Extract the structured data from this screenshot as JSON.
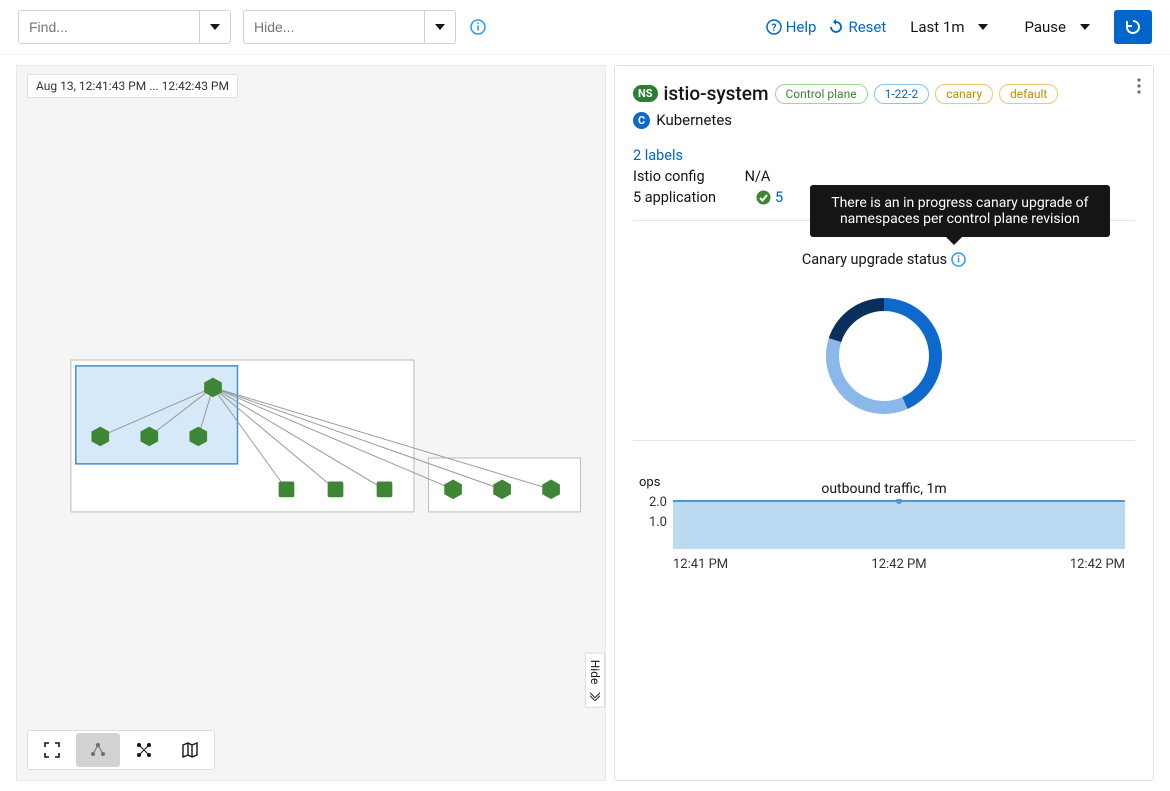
{
  "topbar": {
    "find_placeholder": "Find...",
    "hide_placeholder": "Hide...",
    "help": "Help",
    "reset": "Reset",
    "range": "Last 1m",
    "pause": "Pause"
  },
  "graph": {
    "timestamp": "Aug 13, 12:41:43 PM ... 12:42:43 PM",
    "hide_tab": "Hide"
  },
  "panel": {
    "ns_badge": "NS",
    "title": "istio-system",
    "c_badge": "C",
    "cluster": "Kubernetes",
    "pills": {
      "control_plane": "Control plane",
      "version": "1-22-2",
      "canary": "canary",
      "default": "default"
    },
    "labels_link": "2 labels",
    "istio_config_label": "Istio config",
    "istio_config_value": "N/A",
    "app_label": "5 application",
    "app_value": "5",
    "tooltip": "There is an in progress canary upgrade of namespaces per control plane revision",
    "canary_title": "Canary upgrade status",
    "ops_label": "ops",
    "traffic_title": "outbound traffic, 1m"
  },
  "chart_data": [
    {
      "type": "pie",
      "title": "Canary upgrade status",
      "series": [
        {
          "name": "segment-dark",
          "value": 25,
          "color": "#0a2f5c"
        },
        {
          "name": "segment-blue",
          "value": 40,
          "color": "#0d69cc"
        },
        {
          "name": "segment-light",
          "value": 35,
          "color": "#8bb8e8"
        }
      ]
    },
    {
      "type": "area",
      "title": "outbound traffic, 1m",
      "ylabel": "ops",
      "ylim": [
        0,
        2
      ],
      "y_ticks": [
        "2.0",
        "1.0"
      ],
      "x": [
        "12:41 PM",
        "12:42 PM",
        "12:42 PM"
      ],
      "series": [
        {
          "name": "ops",
          "values": [
            2.0,
            2.0,
            2.0
          ],
          "color": "#bcd9f2",
          "line": "#4f97d1"
        }
      ]
    }
  ]
}
